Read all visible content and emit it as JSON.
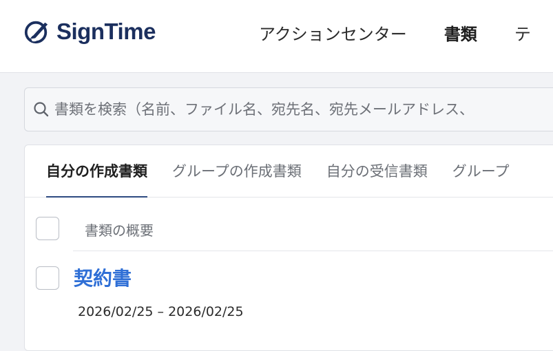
{
  "brand": {
    "name": "SignTime",
    "color": "#1b2f5e"
  },
  "nav": {
    "items": [
      {
        "label": "アクションセンター",
        "active": false
      },
      {
        "label": "書類",
        "active": true
      },
      {
        "label": "テ",
        "active": false
      }
    ]
  },
  "search": {
    "placeholder": "書類を検索（名前、ファイル名、宛先名、宛先メールアドレス、",
    "value": ""
  },
  "tabs": [
    {
      "label": "自分の作成書類",
      "active": true
    },
    {
      "label": "グループの作成書類",
      "active": false
    },
    {
      "label": "自分の受信書類",
      "active": false
    },
    {
      "label": "グループ",
      "active": false
    }
  ],
  "table": {
    "column_header": "書類の概要",
    "rows": [
      {
        "title": "契約書",
        "dates": "2026/02/25 – 2026/02/25"
      }
    ]
  },
  "colors": {
    "link": "#2f6fd6",
    "active_tab_underline": "#2d4a80"
  },
  "icons": {
    "logo": "signtime-logo-icon",
    "search": "search-icon"
  }
}
